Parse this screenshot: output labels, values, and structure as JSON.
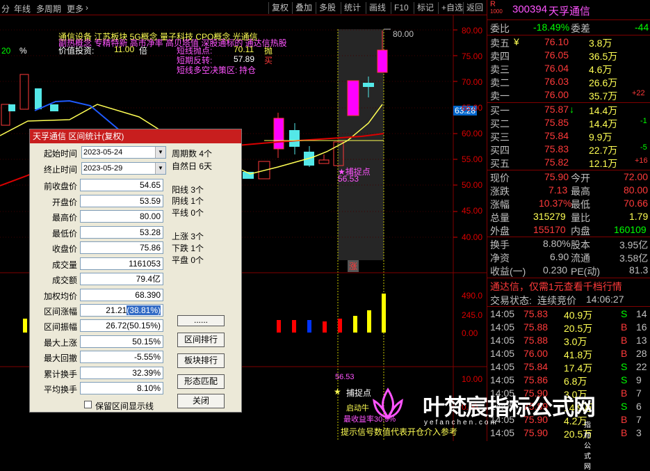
{
  "toolbar": {
    "left": [
      "分",
      "年线",
      "多周期",
      "更多"
    ],
    "more_arrow": "›",
    "right": [
      "复权",
      "叠加",
      "多股",
      "统计",
      "画线",
      "F10",
      "标记",
      "+自选",
      "返回"
    ]
  },
  "chart": {
    "concepts": "通信设备  江苏板块  5G概念 量子科技 CPO概念 光通信",
    "tags_line": "副热概念 专精特新 高市净率 高贝塔值 深股通标的 通达信热股",
    "value_label": "价值投资:",
    "value_num": "11.00",
    "value_unit": "倍",
    "pct_label": "20",
    "pct_sign": "%",
    "short_top_label": "短线抛点:",
    "short_top_val": "70.11",
    "short_top_act": "抛",
    "short_rev_label": "短期反转:",
    "short_rev_val": "57.89",
    "short_rev_act": "买",
    "short_ls_label": "短线多空决策区:",
    "short_ls_val": "持仓",
    "peak_label": "80.00",
    "capture_label": "★捕捉点",
    "capture_val": "56.53",
    "limit_tag": "涨",
    "cur_price_tag": "63.28",
    "y_ticks": [
      "80.00",
      "75.00",
      "70.00",
      "65.00",
      "60.00",
      "55.00",
      "50.00",
      "45.00",
      "40.00"
    ],
    "vol_ticks": [
      "490.0",
      "245.0",
      "0.00"
    ],
    "sub_ticks": [
      "10.00",
      "0.00"
    ],
    "sub_val": "56.53",
    "sub_capture": "捕捉点",
    "sub_a": "启动牛",
    "sub_b": "最收益率30.9%",
    "sub_c": "提示信号数值代表开仓介入参考"
  },
  "quote": {
    "code": "300394",
    "name": "天孚通信",
    "badge_top": "R",
    "badge_bot": "1000",
    "weibi_label": "委比",
    "weibi_val": "-18.49%",
    "weicha_label": "委差",
    "weicha_val": "-44",
    "sells": [
      {
        "label": "卖五",
        "mark": "¥",
        "price": "76.10",
        "vol": "3.8万",
        "chg": ""
      },
      {
        "label": "卖四",
        "mark": "",
        "price": "76.05",
        "vol": "36.5万",
        "chg": ""
      },
      {
        "label": "卖三",
        "mark": "",
        "price": "76.04",
        "vol": "4.6万",
        "chg": ""
      },
      {
        "label": "卖二",
        "mark": "",
        "price": "76.03",
        "vol": "26.6万",
        "chg": ""
      },
      {
        "label": "卖一",
        "mark": "",
        "price": "76.00",
        "vol": "35.7万",
        "chg": "+22"
      }
    ],
    "buys": [
      {
        "label": "买一",
        "mark": "↓",
        "price": "75.87",
        "vol": "14.4万",
        "chg": ""
      },
      {
        "label": "买二",
        "mark": "",
        "price": "75.85",
        "vol": "14.4万",
        "chg": "-1"
      },
      {
        "label": "买三",
        "mark": "",
        "price": "75.84",
        "vol": "9.9万",
        "chg": ""
      },
      {
        "label": "买四",
        "mark": "",
        "price": "75.83",
        "vol": "22.7万",
        "chg": "-5"
      },
      {
        "label": "买五",
        "mark": "",
        "price": "75.82",
        "vol": "12.1万",
        "chg": "+16"
      }
    ],
    "stats": [
      [
        "现价",
        "75.90",
        "今开",
        "72.00"
      ],
      [
        "涨跌",
        "7.13",
        "最高",
        "80.00"
      ],
      [
        "涨幅",
        "10.37%",
        "最低",
        "70.66"
      ],
      [
        "总量",
        "315279",
        "量比",
        "1.79"
      ],
      [
        "外盘",
        "155170",
        "内盘",
        "160109"
      ]
    ],
    "stats2": [
      [
        "换手",
        "8.80%",
        "股本",
        "3.95亿"
      ],
      [
        "净资",
        "6.90",
        "流通",
        "3.58亿"
      ],
      [
        "收益(一)",
        "0.230",
        "PE(动)",
        "81.3"
      ]
    ],
    "promo": "通达信，仅需1元查看千档行情",
    "trade_status_label": "交易状态:",
    "trade_status": "连续竞价",
    "time": "14:06:27",
    "ticks": [
      [
        "14:05",
        "75.83",
        "40.9万",
        "S",
        "14"
      ],
      [
        "14:05",
        "75.88",
        "20.5万",
        "B",
        "16"
      ],
      [
        "14:05",
        "75.88",
        "3.0万",
        "B",
        "13"
      ],
      [
        "14:05",
        "76.00",
        "41.8万",
        "B",
        "28"
      ],
      [
        "14:05",
        "75.84",
        "17.4万",
        "S",
        "22"
      ],
      [
        "14:05",
        "75.86",
        "6.8万",
        "S",
        "9"
      ],
      [
        "14:05",
        "75.90",
        "3.0万",
        "B",
        "7"
      ],
      [
        "14:05",
        "75.89",
        "14.9万",
        "S",
        "6"
      ],
      [
        "14:05",
        "75.90",
        "4.2万",
        "B",
        "7"
      ],
      [
        "14:05",
        "75.90",
        "20.5万",
        "B",
        "3"
      ]
    ]
  },
  "dialog": {
    "title": "天孚通信 区间统计(复权)",
    "start_label": "起始时间",
    "start_val": "2023-05-24",
    "end_label": "终止时间",
    "end_val": "2023-05-29",
    "fields": [
      [
        "前收盘价",
        "54.65"
      ],
      [
        "开盘价",
        "53.59"
      ],
      [
        "最高价",
        "80.00"
      ],
      [
        "最低价",
        "53.28"
      ],
      [
        "收盘价",
        "75.86"
      ],
      [
        "成交量",
        "1161053"
      ],
      [
        "成交额",
        "79.4亿"
      ],
      [
        "加权均价",
        "68.390"
      ]
    ],
    "range_change_label": "区间涨幅",
    "range_change_val": "21.21",
    "range_change_pct": "(38.81%)",
    "fields2": [
      [
        "区间振幅",
        "26.72(50.15%)"
      ],
      [
        "最大上涨",
        "50.15%"
      ],
      [
        "最大回撤",
        "-5.55%"
      ],
      [
        "累计换手",
        "32.39%"
      ],
      [
        "平均换手",
        "8.10%"
      ]
    ],
    "keep_label": "保留区间显示线",
    "stats": [
      "周期数 4个",
      "自然日 6天",
      "阳线 3个",
      "阴线 1个",
      "平线 0个",
      "上涨 3个",
      "下跌 1个",
      "平盘 0个"
    ],
    "buttons": [
      "......",
      "区间排行",
      "板块排行",
      "形态匹配",
      "关闭"
    ]
  },
  "watermark": {
    "text": "叶梵宸指标公式网",
    "url": "yefanchen.com",
    "sub": "指标公式网"
  }
}
